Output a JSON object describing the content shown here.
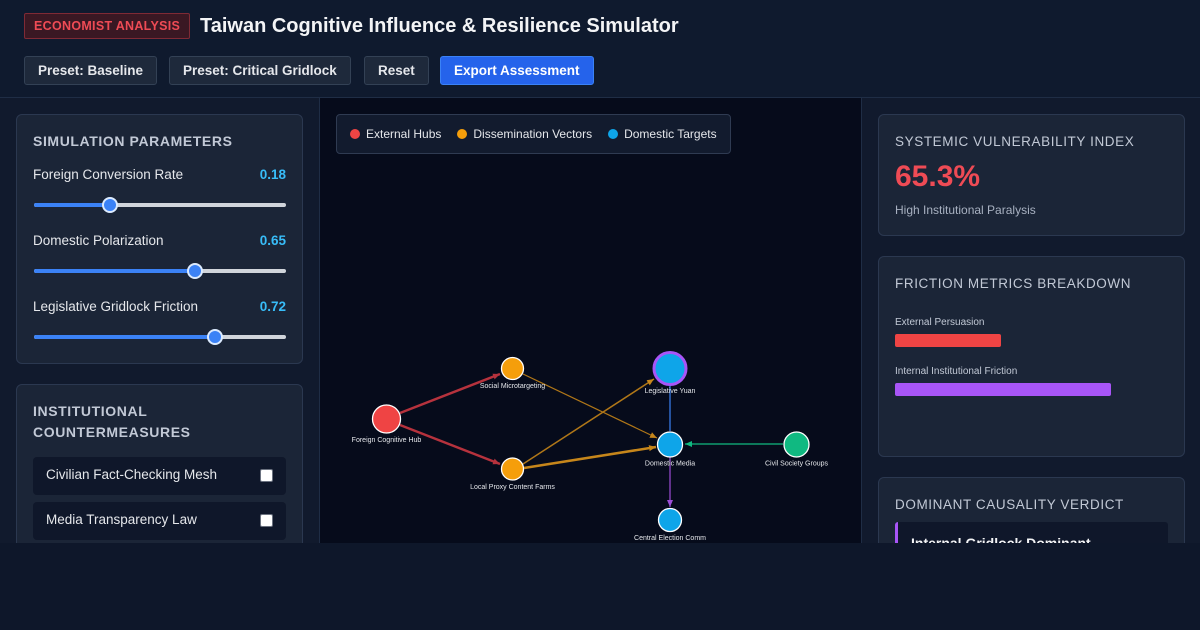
{
  "header": {
    "tag": "ECONOMIST ANALYSIS",
    "title": "Taiwan Cognitive Influence & Resilience Simulator",
    "buttons": {
      "baseline": "Preset: Baseline",
      "gridlock": "Preset: Critical Gridlock",
      "reset": "Reset",
      "export": "Export Assessment"
    }
  },
  "params": {
    "title": "SIMULATION PARAMETERS",
    "items": [
      {
        "label": "Foreign Conversion Rate",
        "value": "0.18",
        "level": 0.3
      },
      {
        "label": "Domestic Polarization",
        "value": "0.65",
        "level": 0.64
      },
      {
        "label": "Legislative Gridlock Friction",
        "value": "0.72",
        "level": 0.72
      }
    ]
  },
  "countermeasures": {
    "title": "INSTITUTIONAL COUNTERMEASURES",
    "items": [
      {
        "label": "Civilian Fact-Checking Mesh",
        "checked": false
      },
      {
        "label": "Media Transparency Law",
        "checked": false
      }
    ]
  },
  "legend": {
    "external": "External Hubs",
    "dissemination": "Dissemination Vectors",
    "domestic": "Domestic Targets"
  },
  "colors": {
    "external": "#ef4444",
    "dissemination": "#f59e0b",
    "domestic": "#0ea5e9",
    "civil": "#10b981",
    "accent": "#a855f7"
  },
  "graph": {
    "nodes": [
      {
        "id": "fch",
        "label": "Foreign Cognitive Hub",
        "group": "external"
      },
      {
        "id": "sm",
        "label": "Social Microtargeting",
        "group": "dissemination"
      },
      {
        "id": "lp",
        "label": "Local Proxy Content Farms",
        "group": "dissemination"
      },
      {
        "id": "ly",
        "label": "Legislative Yuan",
        "group": "domestic"
      },
      {
        "id": "dm",
        "label": "Domestic Media",
        "group": "domestic"
      },
      {
        "id": "csg",
        "label": "Civil Society Groups",
        "group": "civil"
      },
      {
        "id": "cec",
        "label": "Central Election Comm",
        "group": "domestic"
      }
    ]
  },
  "vulnerability": {
    "title": "SYSTEMIC VULNERABILITY INDEX",
    "value": "65.3%",
    "status": "High Institutional Paralysis"
  },
  "friction": {
    "title": "FRICTION METRICS BREAKDOWN",
    "metrics": [
      {
        "label": "External Persuasion",
        "level": 0.39,
        "color": "#ef4444"
      },
      {
        "label": "Internal Institutional Friction",
        "level": 0.79,
        "color": "#a855f7"
      }
    ]
  },
  "verdict": {
    "title": "DOMINANT CAUSALITY VERDICT",
    "headline": "Internal Gridlock Dominant"
  }
}
